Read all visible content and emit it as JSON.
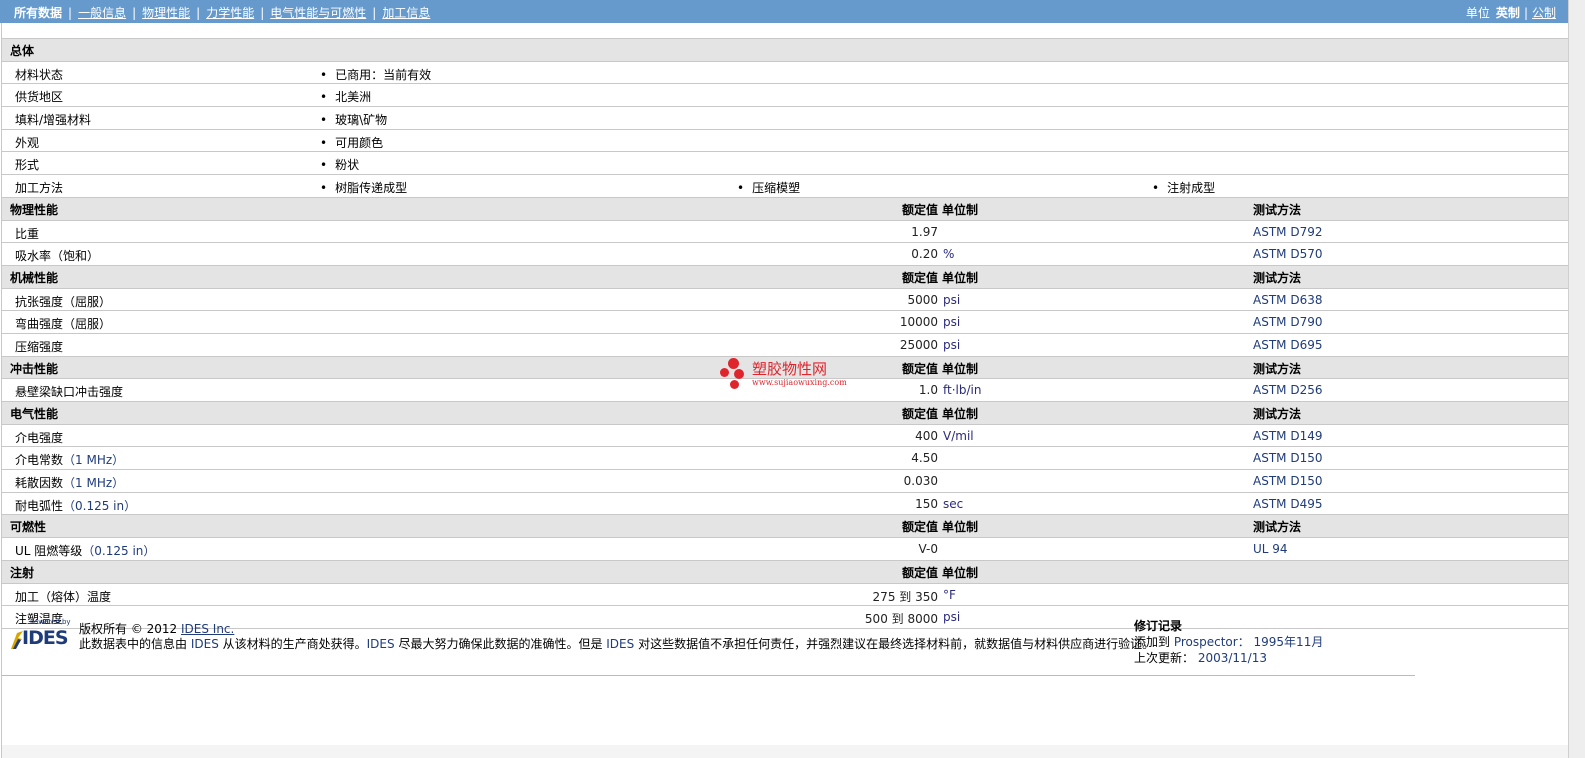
{
  "nav": {
    "current": "所有数据",
    "links": [
      "一般信息",
      "物理性能",
      "力学性能",
      "电气性能与可燃性",
      "加工信息"
    ]
  },
  "units": {
    "label": "单位",
    "english": "英制",
    "metric": "公制"
  },
  "general": {
    "title": "总体",
    "rows": [
      {
        "label": "材料状态",
        "values": [
          "已商用：当前有效"
        ]
      },
      {
        "label": "供货地区",
        "values": [
          "北美洲"
        ]
      },
      {
        "label": "填料/增强材料",
        "values": [
          "玻璃\\矿物"
        ]
      },
      {
        "label": "外观",
        "values": [
          "可用颜色"
        ]
      },
      {
        "label": "形式",
        "values": [
          "粉状"
        ]
      },
      {
        "label": "加工方法",
        "values": [
          "树脂传递成型",
          "压缩模塑",
          "注射成型"
        ]
      }
    ]
  },
  "headers": {
    "nominal": "额定值",
    "unit": "单位制",
    "test": "测试方法"
  },
  "sections": [
    {
      "title": "物理性能",
      "show_test": true,
      "rows": [
        {
          "label": "比重",
          "sub": "",
          "value": "1.97",
          "unit": "",
          "test": "ASTM D792"
        },
        {
          "label": "吸水率（饱和）",
          "sub": "",
          "value": "0.20",
          "unit": "%",
          "test": "ASTM D570"
        }
      ]
    },
    {
      "title": "机械性能",
      "show_test": true,
      "rows": [
        {
          "label": "抗张强度（屈服）",
          "sub": "",
          "value": "5000",
          "unit": "psi",
          "test": "ASTM D638"
        },
        {
          "label": "弯曲强度（屈服）",
          "sub": "",
          "value": "10000",
          "unit": "psi",
          "test": "ASTM D790"
        },
        {
          "label": "压缩强度",
          "sub": "",
          "value": "25000",
          "unit": "psi",
          "test": "ASTM D695"
        }
      ]
    },
    {
      "title": "冲击性能",
      "show_test": true,
      "rows": [
        {
          "label": "悬壁梁缺口冲击强度",
          "sub": "",
          "value": "1.0",
          "unit": "ft·lb/in",
          "test": "ASTM D256"
        }
      ]
    },
    {
      "title": "电气性能",
      "show_test": true,
      "rows": [
        {
          "label": "介电强度",
          "sub": "",
          "value": "400",
          "unit": "V/mil",
          "test": "ASTM D149"
        },
        {
          "label": "介电常数",
          "sub": "（1 MHz）",
          "value": "4.50",
          "unit": "",
          "test": "ASTM D150"
        },
        {
          "label": "耗散因数",
          "sub": "（1 MHz）",
          "value": "0.030",
          "unit": "",
          "test": "ASTM D150"
        },
        {
          "label": "耐电弧性",
          "sub": "（0.125 in）",
          "value": "150",
          "unit": "sec",
          "test": "ASTM D495"
        }
      ]
    },
    {
      "title": "可燃性",
      "show_test": true,
      "rows": [
        {
          "label": "UL 阻燃等级",
          "sub": "（0.125 in）",
          "value": "V-0",
          "unit": "",
          "test": "UL 94"
        }
      ]
    },
    {
      "title": "注射",
      "show_test": false,
      "rows": [
        {
          "label": "加工（熔体）温度",
          "sub": "",
          "value": "275 到  350",
          "unit": "°F",
          "test": ""
        },
        {
          "label": "注塑温度",
          "sub": "",
          "value": "500 到  8000",
          "unit": "psi",
          "test": ""
        }
      ]
    }
  ],
  "watermark": {
    "name": "塑胶物性网",
    "url": "www.sujiaowuxing.com"
  },
  "footer": {
    "logo_powered": "Powered by",
    "logo_text": "IDES",
    "copyright": "版权所有 © 2012 ",
    "company_link": "IDES Inc.",
    "disclaimer_1": "此数据表中的信息由 ",
    "ides_1": "IDES",
    "disclaimer_2": " 从该材料的生产商处获得。",
    "ides_2": "IDES",
    "disclaimer_3": " 尽最大努力确保此数据的准确性。但是 ",
    "ides_3": "IDES",
    "disclaimer_4": " 对这些数据值不承担任何责任，并强烈建议在最终选择材料前，就数据值与材料供应商进行验证。",
    "revision_title": "修订记录",
    "added_label": "添加到 ",
    "added_where": "Prospector：",
    "added_date": " 1995年11月",
    "updated_label": "上次更新：",
    "updated_date": " 2003/11/13"
  }
}
